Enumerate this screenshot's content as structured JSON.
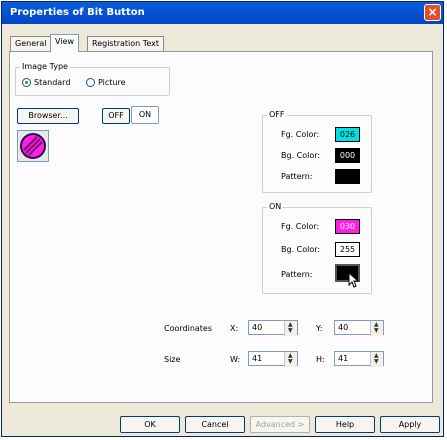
{
  "window": {
    "title": "Properties of Bit Button",
    "close": "×"
  },
  "tabs": [
    {
      "label": "General",
      "active": false
    },
    {
      "label": "View",
      "active": true
    },
    {
      "label": "Registration Text",
      "active": false
    }
  ],
  "image_type": {
    "label": "Image Type",
    "options": [
      {
        "label": "Standard",
        "selected": true
      },
      {
        "label": "Picture",
        "selected": false
      }
    ]
  },
  "browser_button": "Browser...",
  "state_toggle": {
    "off": "OFF",
    "on": "ON",
    "selected": "ON"
  },
  "off_group": {
    "label": "OFF",
    "fg_label": "Fg. Color:",
    "fg_value": "026",
    "fg_color": "#00e0e0",
    "bg_label": "Bg. Color:",
    "bg_value": "000",
    "bg_color": "#000000",
    "pattern_label": "Pattern:"
  },
  "on_group": {
    "label": "ON",
    "fg_label": "Fg. Color:",
    "fg_value": "030",
    "fg_color": "#ff1ee6",
    "bg_label": "Bg. Color:",
    "bg_value": "255",
    "bg_color": "#ffffff",
    "pattern_label": "Pattern:"
  },
  "coordinates": {
    "label": "Coordinates",
    "x_label": "X:",
    "x_value": "40",
    "y_label": "Y:",
    "y_value": "40"
  },
  "size": {
    "label": "Size",
    "w_label": "W:",
    "w_value": "41",
    "h_label": "H:",
    "h_value": "41"
  },
  "buttons": {
    "ok": "OK",
    "cancel": "Cancel",
    "advanced": "Advanced >",
    "help": "Help",
    "apply": "Apply"
  }
}
